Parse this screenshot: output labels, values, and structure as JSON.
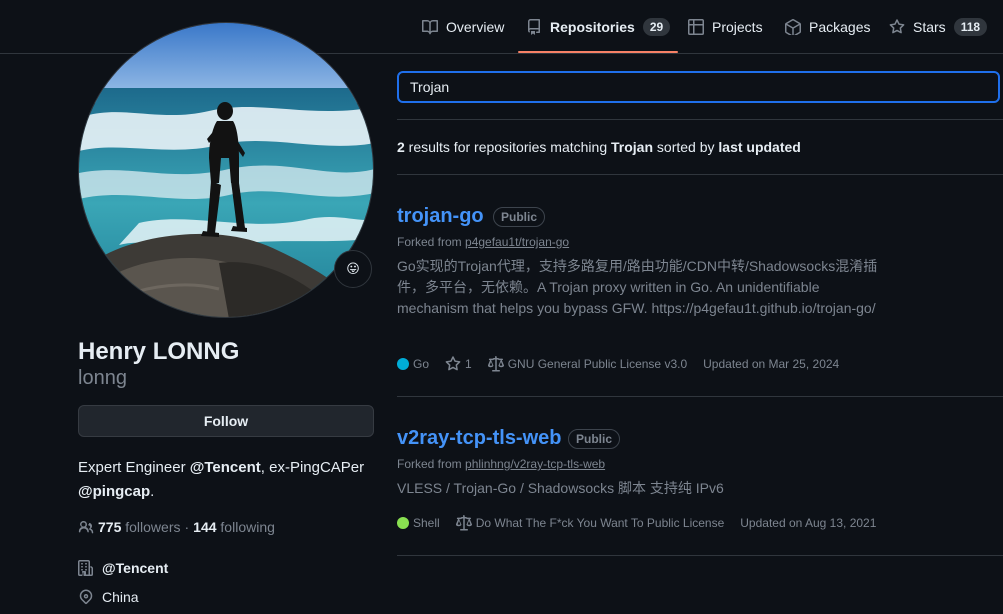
{
  "nav": {
    "tabs": [
      {
        "label": "Overview",
        "icon": "book-icon"
      },
      {
        "label": "Repositories",
        "count": "29",
        "icon": "repo-icon",
        "active": true
      },
      {
        "label": "Projects",
        "icon": "table-icon"
      },
      {
        "label": "Packages",
        "icon": "package-icon"
      },
      {
        "label": "Stars",
        "count": "118",
        "icon": "star-icon"
      }
    ]
  },
  "profile": {
    "status_emoji": "😛",
    "full_name": "Henry LONNG",
    "username": "lonng",
    "follow_label": "Follow",
    "bio": {
      "part1": "Expert Engineer ",
      "org1": "@Tencent",
      "part2": ", ex-PingCAPer ",
      "org2": "@pingcap",
      "part3": "."
    },
    "followers_count": "775",
    "followers_label": "followers",
    "separator": "·",
    "following_count": "144",
    "following_label": "following",
    "company": "@Tencent",
    "location": "China"
  },
  "search": {
    "value": "Trojan"
  },
  "results": {
    "count": "2",
    "text1": " results for repositories matching ",
    "query": "Trojan",
    "text2": " sorted by ",
    "sort": "last updated"
  },
  "repos": [
    {
      "name": "trojan-go",
      "visibility": "Public",
      "forked_prefix": "Forked from ",
      "forked_from": "p4gefau1t/trojan-go",
      "description": "Go实现的Trojan代理，支持多路复用/路由功能/CDN中转/Shadowsocks混淆插件，多平台，无依赖。A Trojan proxy written in Go. An unidentifiable mechanism that helps you bypass GFW. https://p4gefau1t.github.io/trojan-go/",
      "language": "Go",
      "language_color": "#00add8",
      "stars": "1",
      "license": "GNU General Public License v3.0",
      "updated": "Updated on Mar 25, 2024"
    },
    {
      "name": "v2ray-tcp-tls-web",
      "visibility": "Public",
      "forked_prefix": "Forked from ",
      "forked_from": "phlinhng/v2ray-tcp-tls-web",
      "description": "VLESS / Trojan-Go / Shadowsocks 脚本 支持纯 IPv6",
      "language": "Shell",
      "language_color": "#89e051",
      "license": "Do What The F*ck You Want To Public License",
      "updated": "Updated on Aug 13, 2021"
    }
  ]
}
